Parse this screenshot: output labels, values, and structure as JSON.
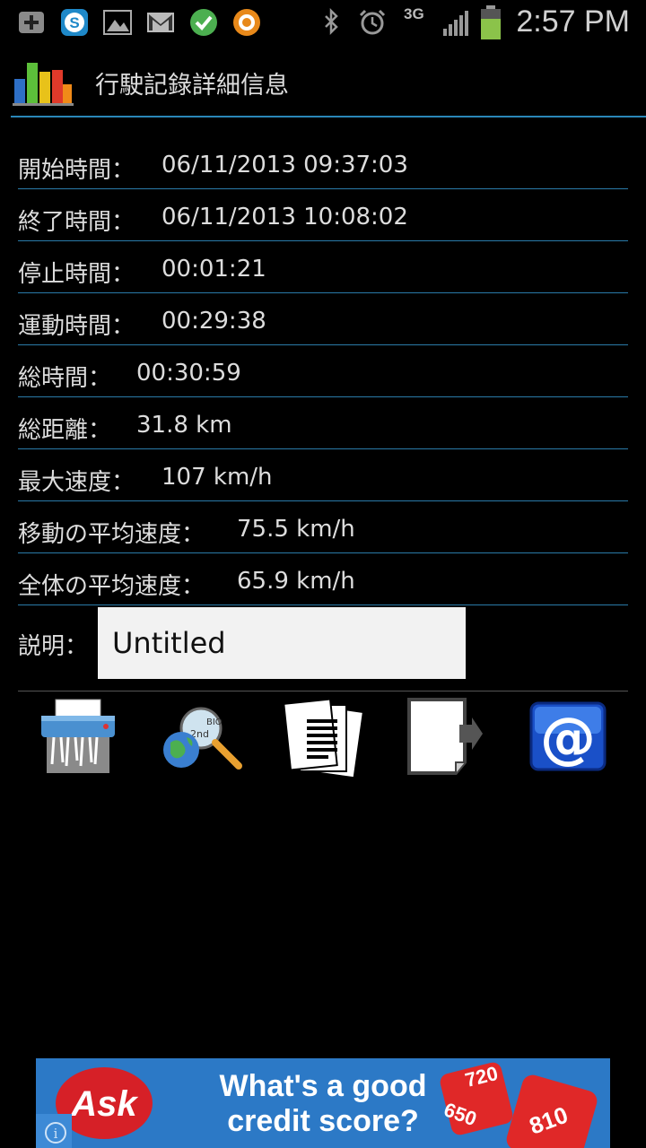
{
  "status_bar": {
    "time": "2:57 PM",
    "network": "3G",
    "icons": [
      "add-icon",
      "skype-icon",
      "gallery-icon",
      "gmail-icon",
      "check-icon",
      "orange-app-icon",
      "bluetooth-icon",
      "alarm-icon",
      "network-3g-icon",
      "signal-icon",
      "battery-icon"
    ]
  },
  "app_bar": {
    "title": "行駛記錄詳細信息",
    "icon": "bar-chart-app-icon"
  },
  "details": [
    {
      "label": "開始時間：",
      "value": "06/11/2013 09:37:03"
    },
    {
      "label": "終了時間：",
      "value": "06/11/2013 10:08:02"
    },
    {
      "label": "停止時間：",
      "value": "00:01:21"
    },
    {
      "label": "運動時間：",
      "value": "00:29:38"
    },
    {
      "label": "総時間：",
      "value": "00:30:59"
    },
    {
      "label": "総距離：",
      "value": "31.8 km"
    },
    {
      "label": "最大速度：",
      "value": "107 km/h"
    },
    {
      "label": "移動の平均速度：",
      "value": "75.5 km/h"
    },
    {
      "label": "全体の平均速度：",
      "value": "65.9 km/h"
    }
  ],
  "description": {
    "label": "説明：",
    "value": "Untitled"
  },
  "toolbar": [
    "shredder-delete-icon",
    "globe-search-icon",
    "documents-icon",
    "export-icon",
    "email-icon"
  ],
  "ad": {
    "brand": "Ask",
    "line1": "What's a good",
    "line2": "credit score?",
    "dice": [
      "720",
      "650",
      "810"
    ],
    "brand_color": "#d62027",
    "bg_color": "#2c79c6"
  }
}
